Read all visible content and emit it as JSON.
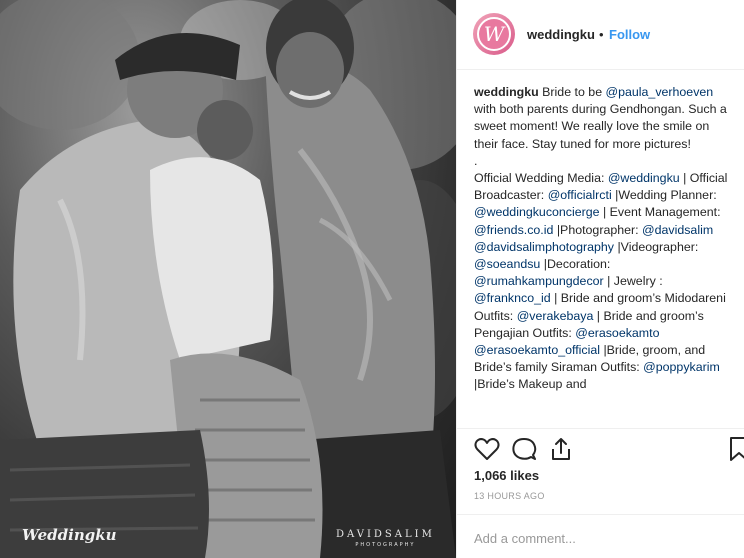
{
  "photo": {
    "alt_description": "",
    "watermark_left": "Weddingku",
    "watermark_right": "DAVIDSALIM",
    "watermark_right_sub": "PHOTOGRAPHY"
  },
  "header": {
    "avatar_letter": "W",
    "username": "weddingku",
    "separator": "•",
    "follow_label": "Follow"
  },
  "caption": {
    "username": "weddingku",
    "segments": [
      {
        "t": "text",
        "v": " Bride to be "
      },
      {
        "t": "mention",
        "v": "@paula_verhoeven"
      },
      {
        "t": "text",
        "v": " with both parents during Gendhongan. Such a sweet moment! We really love the smile on their face. Stay tuned for more pictures!"
      },
      {
        "t": "br"
      },
      {
        "t": "text",
        "v": "."
      },
      {
        "t": "br"
      },
      {
        "t": "text",
        "v": "Official Wedding Media: "
      },
      {
        "t": "mention",
        "v": "@weddingku"
      },
      {
        "t": "text",
        "v": " | Official Broadcaster: "
      },
      {
        "t": "mention",
        "v": "@officialrcti"
      },
      {
        "t": "text",
        "v": " |Wedding Planner: "
      },
      {
        "t": "mention",
        "v": "@weddingkuconcierge"
      },
      {
        "t": "text",
        "v": " | Event Management: "
      },
      {
        "t": "mention",
        "v": "@friends.co.id"
      },
      {
        "t": "text",
        "v": " |Photographer: "
      },
      {
        "t": "mention",
        "v": "@davidsalim"
      },
      {
        "t": "text",
        "v": " "
      },
      {
        "t": "mention",
        "v": "@davidsalimphotography"
      },
      {
        "t": "text",
        "v": " |Videographer: "
      },
      {
        "t": "mention",
        "v": "@soeandsu"
      },
      {
        "t": "text",
        "v": " |Decoration: "
      },
      {
        "t": "mention",
        "v": "@rumahkampungdecor"
      },
      {
        "t": "text",
        "v": " | Jewelry : "
      },
      {
        "t": "mention",
        "v": "@franknco_id"
      },
      {
        "t": "text",
        "v": " | Bride and groom’s Midodareni Outfits: "
      },
      {
        "t": "mention",
        "v": "@verakebaya"
      },
      {
        "t": "text",
        "v": " | Bride and groom’s Pengajian Outfits: "
      },
      {
        "t": "mention",
        "v": "@erasoekamto"
      },
      {
        "t": "text",
        "v": " "
      },
      {
        "t": "mention",
        "v": "@erasoekamto_official"
      },
      {
        "t": "text",
        "v": " |Bride, groom, and Bride’s family Siraman Outfits: "
      },
      {
        "t": "mention",
        "v": "@poppykarim"
      },
      {
        "t": "text",
        "v": " |Bride’s Makeup and"
      }
    ]
  },
  "actions": {
    "like_icon": "heart-icon",
    "comment_icon": "speech-bubble-icon",
    "share_icon": "share-icon",
    "save_icon": "bookmark-icon"
  },
  "likes": "1,066 likes",
  "timestamp": "13 HOURS AGO",
  "comment_box": {
    "placeholder": "Add a comment..."
  },
  "colors": {
    "link": "#3897f0",
    "mention": "#003569",
    "text": "#262626",
    "muted": "#999999",
    "border": "#efefef",
    "avatar": "#e8799f"
  }
}
